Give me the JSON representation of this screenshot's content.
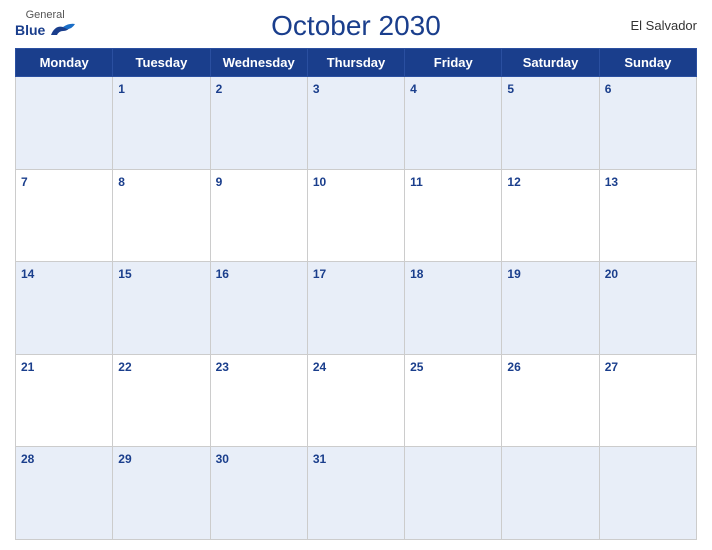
{
  "header": {
    "logo_general": "General",
    "logo_blue": "Blue",
    "month_title": "October 2030",
    "country": "El Salvador"
  },
  "weekdays": [
    "Monday",
    "Tuesday",
    "Wednesday",
    "Thursday",
    "Friday",
    "Saturday",
    "Sunday"
  ],
  "weeks": [
    [
      null,
      1,
      2,
      3,
      4,
      5,
      6
    ],
    [
      7,
      8,
      9,
      10,
      11,
      12,
      13
    ],
    [
      14,
      15,
      16,
      17,
      18,
      19,
      20
    ],
    [
      21,
      22,
      23,
      24,
      25,
      26,
      27
    ],
    [
      28,
      29,
      30,
      31,
      null,
      null,
      null
    ]
  ]
}
